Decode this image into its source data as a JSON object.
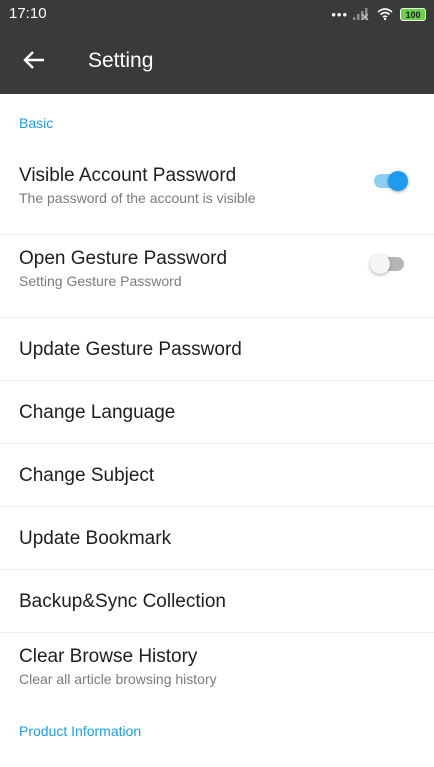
{
  "status_bar": {
    "time": "17:10",
    "dots": "•••",
    "battery": "100",
    "signal_icon": "signal-off-icon",
    "wifi_icon": "wifi-icon"
  },
  "appbar": {
    "back_icon": "arrow-left-icon",
    "title": "Setting"
  },
  "colors": {
    "bar_bg": "#3a3a3a",
    "accent": "#1aa0e0",
    "toggle_on": "#1e9bf0",
    "battery": "#6ad04a"
  },
  "sections": {
    "basic": "Basic",
    "product_information": "Product Information"
  },
  "items": {
    "visible_account_password": {
      "title": "Visible Account Password",
      "subtitle": "The password of the account is visible",
      "toggle": "on"
    },
    "open_gesture_password": {
      "title": "Open Gesture Password",
      "subtitle": "Setting Gesture Password",
      "toggle": "off"
    },
    "update_gesture_password": {
      "title": "Update Gesture Password"
    },
    "change_language": {
      "title": "Change Language"
    },
    "change_subject": {
      "title": "Change Subject"
    },
    "update_bookmark": {
      "title": "Update Bookmark"
    },
    "backup_sync_collection": {
      "title": "Backup&Sync Collection"
    },
    "clear_browse_history": {
      "title": "Clear Browse History",
      "subtitle": "Clear all article browsing history"
    }
  }
}
